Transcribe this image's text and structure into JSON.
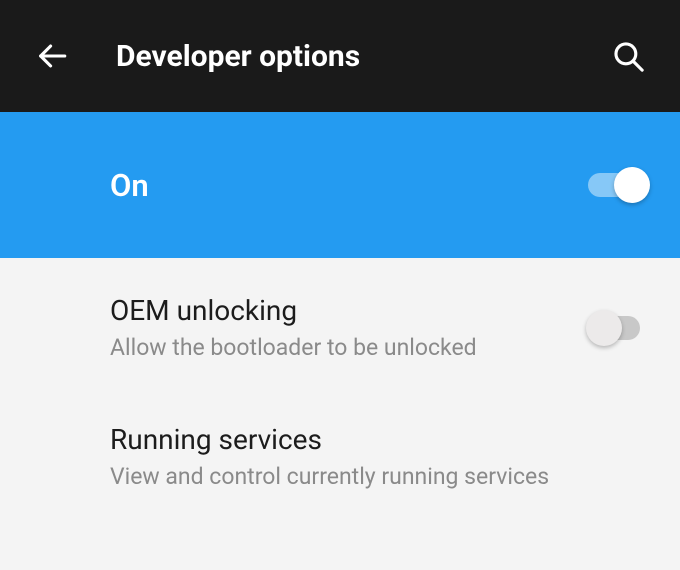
{
  "header": {
    "title": "Developer options"
  },
  "master_toggle": {
    "label": "On",
    "state": "on"
  },
  "items": [
    {
      "title": "OEM unlocking",
      "subtitle": "Allow the bootloader to be unlocked",
      "has_switch": true,
      "switch_state": "off"
    },
    {
      "title": "Running services",
      "subtitle": "View and control currently running services",
      "has_switch": false
    }
  ]
}
